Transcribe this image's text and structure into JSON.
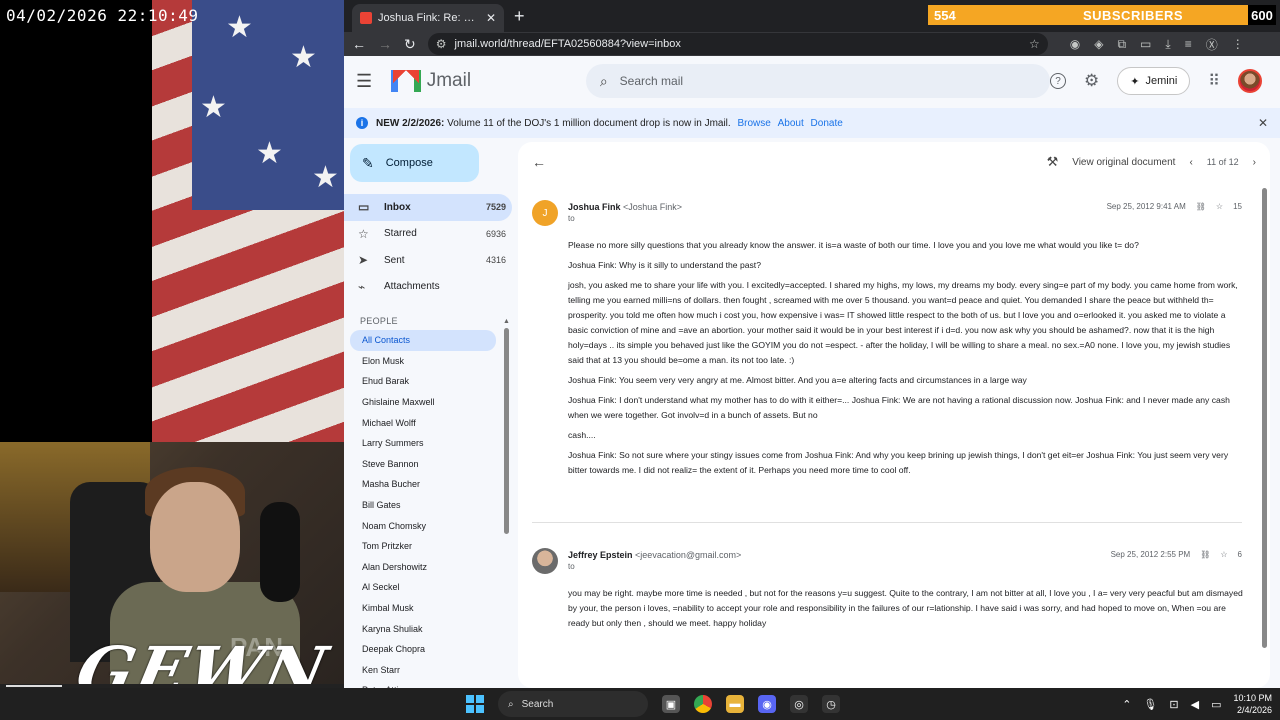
{
  "stream": {
    "timestamp": "04/02/2026 22:10:49",
    "watermark": "GEWN",
    "webcam_overlay": "PAN",
    "subscribers": {
      "count": "554",
      "label": "SUBSCRIBERS",
      "goal": "600"
    }
  },
  "browser": {
    "tab_title": "Joshua Fink: Re: — Epstein Ema",
    "url": "jmail.world/thread/EFTA02560884?view=inbox"
  },
  "app": {
    "logo": "Jmail",
    "search_placeholder": "Search mail",
    "assistant_label": "Jemini",
    "banner": {
      "bold": "NEW 2/2/2026:",
      "text": "Volume 11 of the DOJ's 1 million document drop is now in Jmail.",
      "links": [
        "Browse",
        "About",
        "Donate"
      ]
    },
    "compose_label": "Compose",
    "nav": [
      {
        "icon": "inbox-icon",
        "label": "Inbox",
        "count": "7529",
        "active": true
      },
      {
        "icon": "star-icon",
        "label": "Starred",
        "count": "6936",
        "active": false
      },
      {
        "icon": "send-icon",
        "label": "Sent",
        "count": "4316",
        "active": false
      },
      {
        "icon": "paperclip-icon",
        "label": "Attachments",
        "count": "",
        "active": false
      }
    ],
    "people_header": "PEOPLE",
    "people": [
      "All Contacts",
      "Elon Musk",
      "Ehud Barak",
      "Ghislaine Maxwell",
      "Michael Wolff",
      "Larry Summers",
      "Steve Bannon",
      "Masha Bucher",
      "Bill Gates",
      "Noam Chomsky",
      "Tom Pritzker",
      "Alan Dershowitz",
      "Al Seckel",
      "Kimbal Musk",
      "Karyna Shuliak",
      "Deepak Chopra",
      "Ken Starr",
      "Peter Attia"
    ],
    "toolbar": {
      "view_original": "View original document",
      "pager": "11 of 12"
    },
    "messages": [
      {
        "initial": "J",
        "name": "Joshua Fink",
        "email": "<Joshua Fink>",
        "to": "to",
        "date": "Sep 25, 2012 9:41 AM",
        "count": "15",
        "paragraphs": [
          "Please no more silly questions that you already know the answer. it is=a waste of both our time. I love you and you love me what would you like t= do?",
          "Joshua Fink: Why is it silly to understand the past?",
          "josh, you asked me to share your life with you. I excitedly=accepted. I shared my highs, my lows, my dreams my body. every sing=e part of my body. you came home from work, telling me you earned milli=ns of dollars. then fought , screamed with me over 5 thousand. you want=d peace and quiet. You demanded I share the peace but withheld th= prosperity. you told me often how much i cost you, how expensive i was= IT showed little respect to the both of us. but I love you and o=erlooked it. you asked me to violate a basic conviction of mine and =ave an abortion. your mother said it would be in your best interest if i d=d. you now ask why you should be ashamed?. now that it is the high holy=days .. its simple you behaved just like the GOYIM you do not =espect. - after the holiday, I will be willing to share a meal. no sex.=A0 none. I love you, my jewish studies said that at 13 you should be=ome a man. its not too late. :)",
          "Joshua Fink: You seem very very angry at me. Almost bitter. And you a=e altering facts and circumstances in a large way",
          "Joshua Fink: I don't understand what my mother has to do with it either=... Joshua Fink: We are not having a rational discussion now. Joshua Fink: and I never made any cash when we were together. Got involv=d in a bunch of assets. But no",
          "cash....",
          "Joshua Fink: So not sure where your stingy issues come from Joshua Fink: And why you keep brining up jewish things, I don't get eit=er Joshua Fink: You just seem very very bitter towards me. I did not realiz= the extent of it. Perhaps you need more time to cool off."
        ]
      },
      {
        "initial": "",
        "name": "Jeffrey Epstein",
        "email": "<jeevacation@gmail.com>",
        "to": "to",
        "date": "Sep 25, 2012 2:55 PM",
        "count": "6",
        "paragraphs": [
          "you may be right. maybe more time is needed , but not for the reasons y=u suggest. Quite to the contrary, I am not bitter at all, I love you , I a= very very peacful but am dismayed by your, the person i loves, =nability to accept your role and responsibility in the failures of our r=lationship. I have said i was sorry, and had hoped to move on, When =ou are ready but only then , should we meet. happy holiday"
        ]
      }
    ]
  },
  "taskbar": {
    "search_label": "Search",
    "time": "10:10 PM",
    "date": "2/4/2026"
  },
  "dock_badge": "1"
}
